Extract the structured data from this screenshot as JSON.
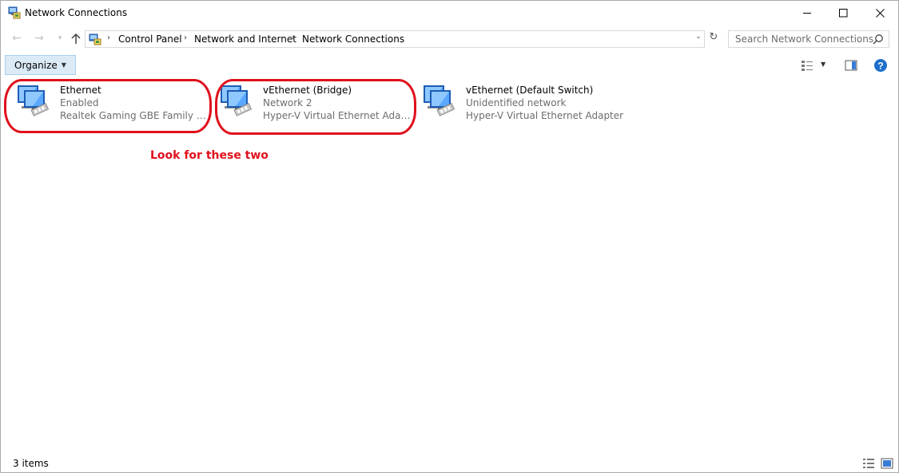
{
  "window": {
    "title": "Network Connections",
    "icon": "network-connections-icon",
    "controls": {
      "minimize": "minimize-icon",
      "maximize": "maximize-icon",
      "close": "close-icon"
    }
  },
  "nav": {
    "breadcrumbs": [
      "Control Panel",
      "Network and Internet",
      "Network Connections"
    ],
    "search_placeholder": "Search Network Connections"
  },
  "commandbar": {
    "organize_label": "Organize"
  },
  "connections": [
    {
      "name": "Ethernet",
      "status": "Enabled",
      "adapter": "Realtek Gaming GBE Family Contr...",
      "highlighted": true
    },
    {
      "name": "vEthernet (Bridge)",
      "status": "Network 2",
      "adapter": "Hyper-V Virtual Ethernet Adapter ...",
      "highlighted": true
    },
    {
      "name": "vEthernet (Default Switch)",
      "status": "Unidentified network",
      "adapter": "Hyper-V Virtual Ethernet Adapter",
      "highlighted": false
    }
  ],
  "annotation": {
    "text": "Look for these two",
    "color": "#e0101c"
  },
  "status": {
    "item_count": "3 items"
  },
  "colors": {
    "organize_bg": "#dbeaf7",
    "secondary_text": "#6d6d6d",
    "help_blue": "#1e6fc9"
  }
}
